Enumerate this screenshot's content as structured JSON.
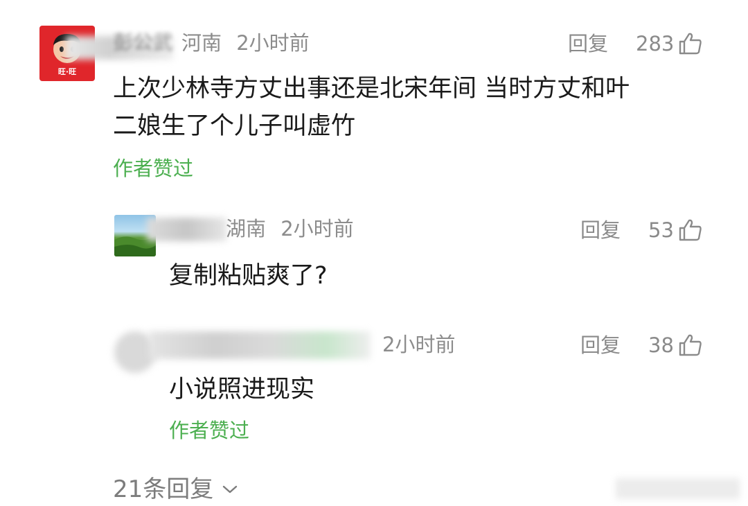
{
  "comment": {
    "username": "彭公武",
    "location": "河南",
    "time": "2小时前",
    "reply_label": "回复",
    "likes": "283",
    "text_line1": "上次少林寺方丈出事还是北宋年间 当时方丈和叶",
    "text_line2": "二娘生了个儿子叫虚竹",
    "author_liked": "作者赞过",
    "avatar_badge": "旺·旺"
  },
  "replies": [
    {
      "location": "湖南",
      "time": "2小时前",
      "reply_label": "回复",
      "likes": "53",
      "text": "复制粘贴爽了?"
    },
    {
      "time": "2小时前",
      "reply_label": "回复",
      "likes": "38",
      "text": "小说照进现实",
      "author_liked": "作者赞过"
    }
  ],
  "more_replies": {
    "label": "21条回复"
  },
  "colors": {
    "accent_green": "#4caf50",
    "meta_gray": "#8c8c8c",
    "avatar_red": "#e0262b"
  }
}
